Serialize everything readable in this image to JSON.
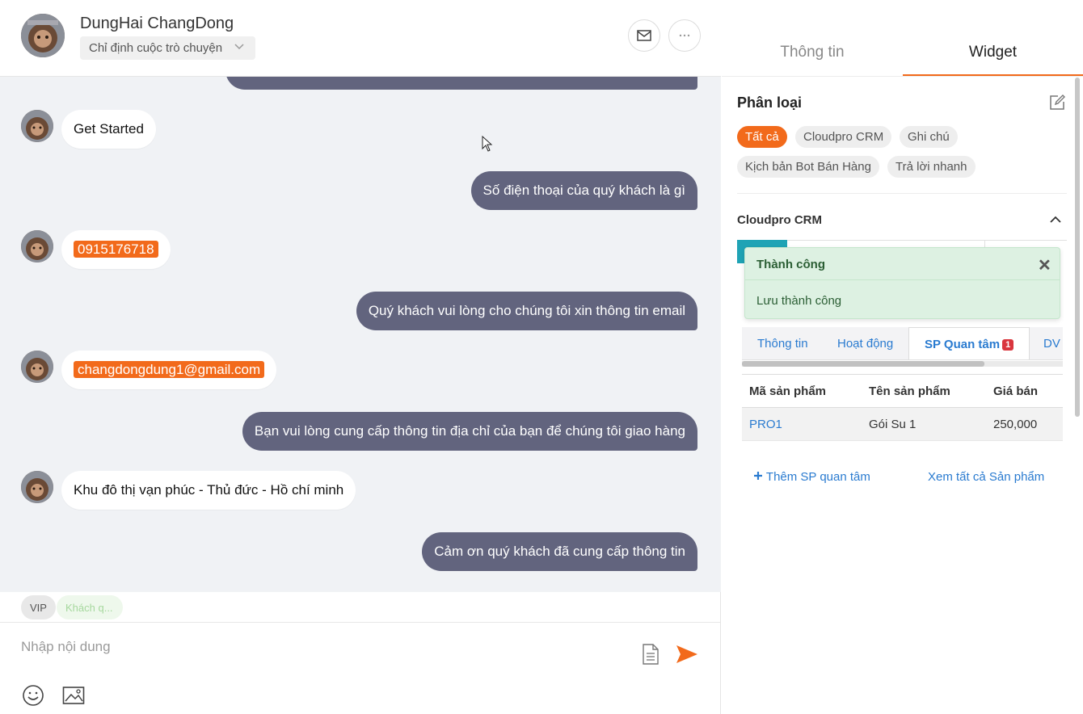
{
  "header": {
    "name": "DungHai ChangDong",
    "assign_label": "Chỉ định cuộc trò chuyện"
  },
  "messages": [
    {
      "side": "in",
      "text": "Get Started",
      "highlight": false
    },
    {
      "side": "out",
      "text": "Số điện thoại của quý khách là gì"
    },
    {
      "side": "in",
      "text": "0915176718",
      "highlight": true
    },
    {
      "side": "out",
      "text": "Quý khách vui lòng cho chúng tôi xin thông tin email"
    },
    {
      "side": "in",
      "text": "changdongdung1@gmail.com",
      "highlight": true
    },
    {
      "side": "out",
      "text": "Bạn vui lòng cung cấp thông tin địa chỉ của bạn để chúng tôi giao hàng"
    },
    {
      "side": "in",
      "text": "Khu đô thị vạn phúc - Thủ đức - Hồ chí minh",
      "highlight": false
    },
    {
      "side": "out",
      "text": "Cảm ơn quý khách đã cung cấp thông tin"
    }
  ],
  "tags": {
    "vip": "VIP",
    "customer": "Khách q..."
  },
  "composer": {
    "placeholder": "Nhập nội dung"
  },
  "side_tabs": {
    "info": "Thông tin",
    "widget": "Widget"
  },
  "classification": {
    "title": "Phân loại",
    "chips": [
      "Tất cả",
      "Cloudpro CRM",
      "Ghi chú",
      "Kịch bản Bot Bán Hàng",
      "Trả lời nhanh"
    ]
  },
  "crm": {
    "title": "Cloudpro CRM"
  },
  "toast": {
    "title": "Thành công",
    "close": "✕",
    "message": "Lưu thành công"
  },
  "subtabs": {
    "info": "Thông tin",
    "activity": "Hoạt động",
    "products": "SP Quan tâm",
    "products_badge": "1",
    "services": "DV"
  },
  "product_table": {
    "headers": [
      "Mã sản phẩm",
      "Tên sản phẩm",
      "Giá bán"
    ],
    "rows": [
      [
        "PRO1",
        "Gói Su 1",
        "250,000"
      ]
    ]
  },
  "actions": {
    "add": "Thêm SP quan tâm",
    "view_all": "Xem tất cả Sản phẩm"
  },
  "colors": {
    "accent": "#f26a1b",
    "outgoing_bubble": "#62647e",
    "link": "#2a7bd0",
    "success_bg": "#ddf1e2"
  }
}
